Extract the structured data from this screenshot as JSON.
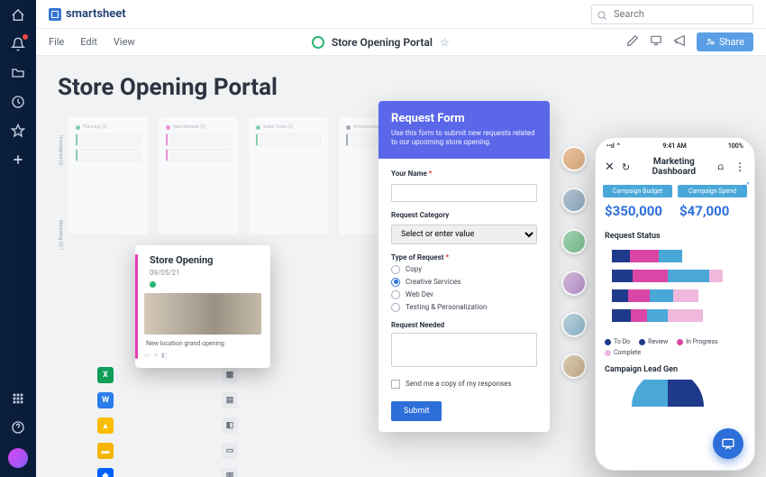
{
  "brand": "smartsheet",
  "search": {
    "placeholder": "Search"
  },
  "menu": {
    "file": "File",
    "edit": "Edit",
    "view": "View"
  },
  "page": {
    "title": "Store Opening Portal",
    "heading": "Store Opening Portal"
  },
  "share_label": "Share",
  "boards": {
    "rows": [
      "Unassigned (2)",
      "Marketing (3) 1"
    ],
    "cols": [
      {
        "label": "Planning (3)",
        "color": "#2bb673"
      },
      {
        "label": "New Release (2)",
        "color": "#e63db5"
      },
      {
        "label": "Sales Tools (2)",
        "color": "#2bb673"
      },
      {
        "label": "Announcements",
        "color": "#6b7280"
      }
    ]
  },
  "card": {
    "title": "Store Opening",
    "date": "09/05/21",
    "caption": "New location grand opening"
  },
  "form": {
    "title": "Request Form",
    "subtitle": "Use this form to submit new requests related to our upcoming store opening.",
    "name_label": "Your Name",
    "category_label": "Request Category",
    "category_placeholder": "Select or enter value",
    "type_label": "Type of Request",
    "types": [
      "Copy",
      "Creative Services",
      "Web Dev",
      "Testing & Personalization"
    ],
    "selected_type": "Creative Services",
    "needed_label": "Request Needed",
    "send_copy": "Send me a copy of my responses",
    "submit": "Submit"
  },
  "phone": {
    "time": "9:41 AM",
    "battery": "100%",
    "title": "Marketing Dashboard",
    "metric1_label": "Campaign Budget",
    "metric1_value": "$350,000",
    "metric2_label": "Campaign Spend",
    "metric2_value": "$47,000",
    "section1": "Request Status",
    "legend": [
      {
        "label": "To Do",
        "color": "#1e3a8a"
      },
      {
        "label": "Review",
        "color": "#1e3a8a"
      },
      {
        "label": "In Progress",
        "color": "#d946a6"
      },
      {
        "label": "Complete",
        "color": "#f0b8dd"
      }
    ],
    "section2": "Campaign Lead Gen"
  },
  "chart_data": {
    "type": "bar",
    "orientation": "horizontal",
    "stacked": true,
    "title": "Request Status",
    "series_colors": {
      "To Do": "#1e3a8a",
      "In Progress": "#d946a6",
      "Review": "#4aa8d8",
      "Complete": "#f0b8dd"
    },
    "rows": [
      {
        "segments": [
          {
            "name": "To Do",
            "v": 15
          },
          {
            "name": "In Progress",
            "v": 25
          },
          {
            "name": "Review",
            "v": 20
          }
        ]
      },
      {
        "segments": [
          {
            "name": "To Do",
            "v": 18
          },
          {
            "name": "In Progress",
            "v": 30
          },
          {
            "name": "Review",
            "v": 35
          },
          {
            "name": "Complete",
            "v": 12
          }
        ]
      },
      {
        "segments": [
          {
            "name": "To Do",
            "v": 14
          },
          {
            "name": "In Progress",
            "v": 18
          },
          {
            "name": "Review",
            "v": 20
          },
          {
            "name": "Complete",
            "v": 22
          }
        ]
      },
      {
        "segments": [
          {
            "name": "To Do",
            "v": 16
          },
          {
            "name": "In Progress",
            "v": 14
          },
          {
            "name": "Review",
            "v": 18
          },
          {
            "name": "Complete",
            "v": 30
          }
        ]
      }
    ]
  }
}
